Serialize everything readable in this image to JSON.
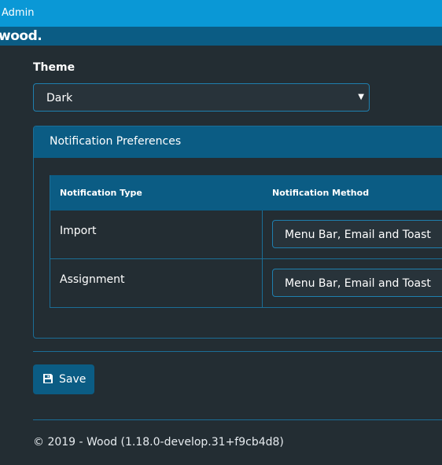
{
  "topbar": {
    "admin_label": "Admin"
  },
  "brand": {
    "logo_text": "wood."
  },
  "theme": {
    "label": "Theme",
    "selected": "Dark"
  },
  "notifications": {
    "title": "Notification Preferences",
    "columns": [
      "Notification Type",
      "Notification Method"
    ],
    "rows": [
      {
        "type": "Import",
        "method": "Menu Bar, Email and Toast"
      },
      {
        "type": "Assignment",
        "method": "Menu Bar, Email and Toast"
      }
    ]
  },
  "actions": {
    "save_label": "Save"
  },
  "footer": {
    "text": "© 2019 - Wood (1.18.0-develop.31+f9cb4d8)"
  }
}
